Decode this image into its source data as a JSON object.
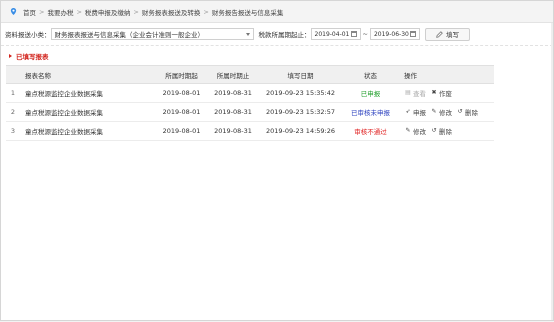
{
  "breadcrumb": {
    "items": [
      "首页",
      "我要办税",
      "税费申报及缴纳",
      "财务报表报送及转换",
      "财务报告报送与信息采集"
    ]
  },
  "filter": {
    "category_label": "资料报送小类：",
    "category_value": "财务报表报送与信息采集（企业会计准则一般企业）",
    "period_label": "税款所属期起止：",
    "date_from": "2019-04-01",
    "date_sep": "~",
    "date_to": "2019-06-30",
    "fill_button": "填写"
  },
  "section_title": "已填写报表",
  "table": {
    "headers": [
      "",
      "报表名称",
      "所属时期起",
      "所属时期止",
      "填写日期",
      "状态",
      "操作"
    ],
    "rows": [
      {
        "no": "1",
        "name": "童点税源监控企业数据采集",
        "start": "2019-08-01",
        "end": "2019-08-31",
        "filled": "2019-09-23 15:35:42",
        "status": "已申报",
        "status_color": "#1f9e2a",
        "ops": [
          {
            "label": "查看",
            "icon": "view-icon",
            "disabled": true
          },
          {
            "label": "作废",
            "icon": "close-x-icon",
            "disabled": false
          }
        ]
      },
      {
        "no": "2",
        "name": "童点税源监控企业数据采集",
        "start": "2019-08-01",
        "end": "2019-08-31",
        "filled": "2019-09-23 15:32:57",
        "status": "已审核未申报",
        "status_color": "#2a3fbf",
        "ops": [
          {
            "label": "申报",
            "icon": "send-icon",
            "disabled": false
          },
          {
            "label": "修改",
            "icon": "edit-icon",
            "disabled": false
          },
          {
            "label": "删除",
            "icon": "undo-icon",
            "disabled": false
          }
        ]
      },
      {
        "no": "3",
        "name": "童点税源监控企业数据采集",
        "start": "2019-08-01",
        "end": "2019-08-31",
        "filled": "2019-09-23 14:59:26",
        "status": "审核不通过",
        "status_color": "#e02020",
        "ops": [
          {
            "label": "修改",
            "icon": "edit-icon",
            "disabled": false
          },
          {
            "label": "删除",
            "icon": "undo-icon",
            "disabled": false
          }
        ]
      }
    ]
  },
  "colors": {
    "accent_red": "#d2231c",
    "pin_blue": "#3a8ee6"
  }
}
